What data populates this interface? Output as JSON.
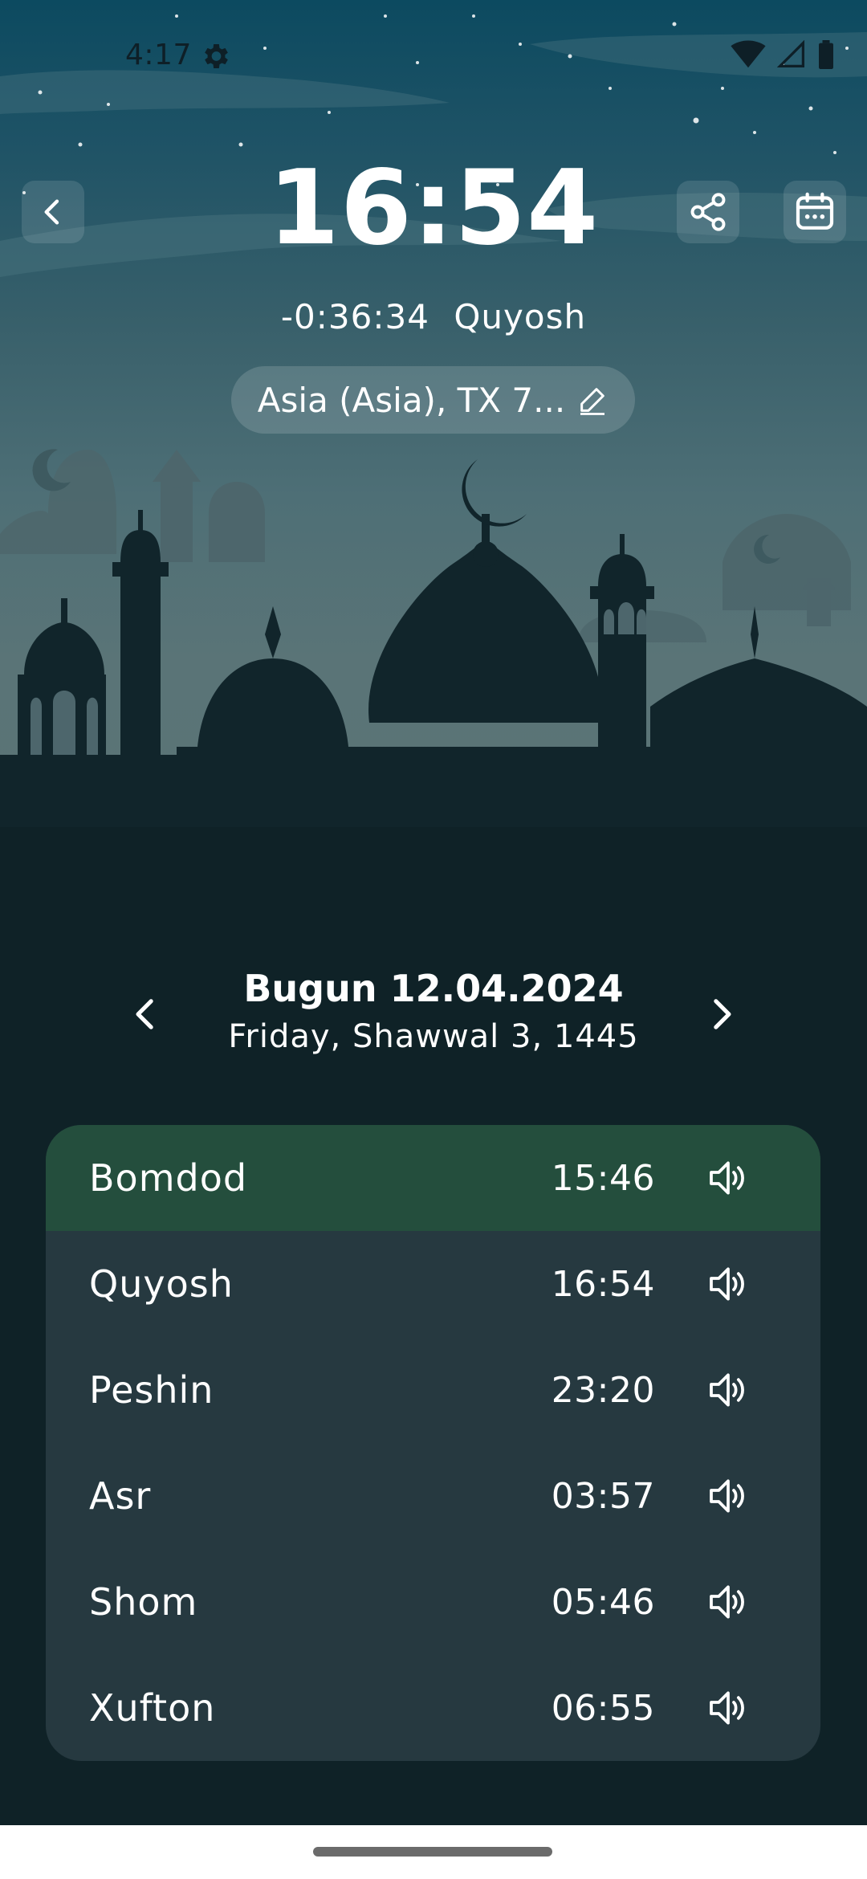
{
  "status_bar": {
    "time": "4:17",
    "icons": [
      "settings-gear-icon",
      "wifi-icon",
      "signal-icon",
      "battery-icon"
    ]
  },
  "header": {
    "current_time": "16:54",
    "countdown": "-0:36:34",
    "next_prayer": "Quyosh",
    "location": "Asia (Asia), TX 7..."
  },
  "date_nav": {
    "title": "Bugun 12.04.2024",
    "subtitle": "Friday, Shawwal 3, 1445"
  },
  "prayers": [
    {
      "name": "Bomdod",
      "time": "15:46",
      "active": true
    },
    {
      "name": "Quyosh",
      "time": "16:54",
      "active": false
    },
    {
      "name": "Peshin",
      "time": "23:20",
      "active": false
    },
    {
      "name": "Asr",
      "time": "03:57",
      "active": false
    },
    {
      "name": "Shom",
      "time": "05:46",
      "active": false
    },
    {
      "name": "Xufton",
      "time": "06:55",
      "active": false
    }
  ],
  "colors": {
    "active_row": "#244e3d",
    "card": "#263940",
    "background": "#0f2227",
    "silhouette": "#11252b"
  }
}
